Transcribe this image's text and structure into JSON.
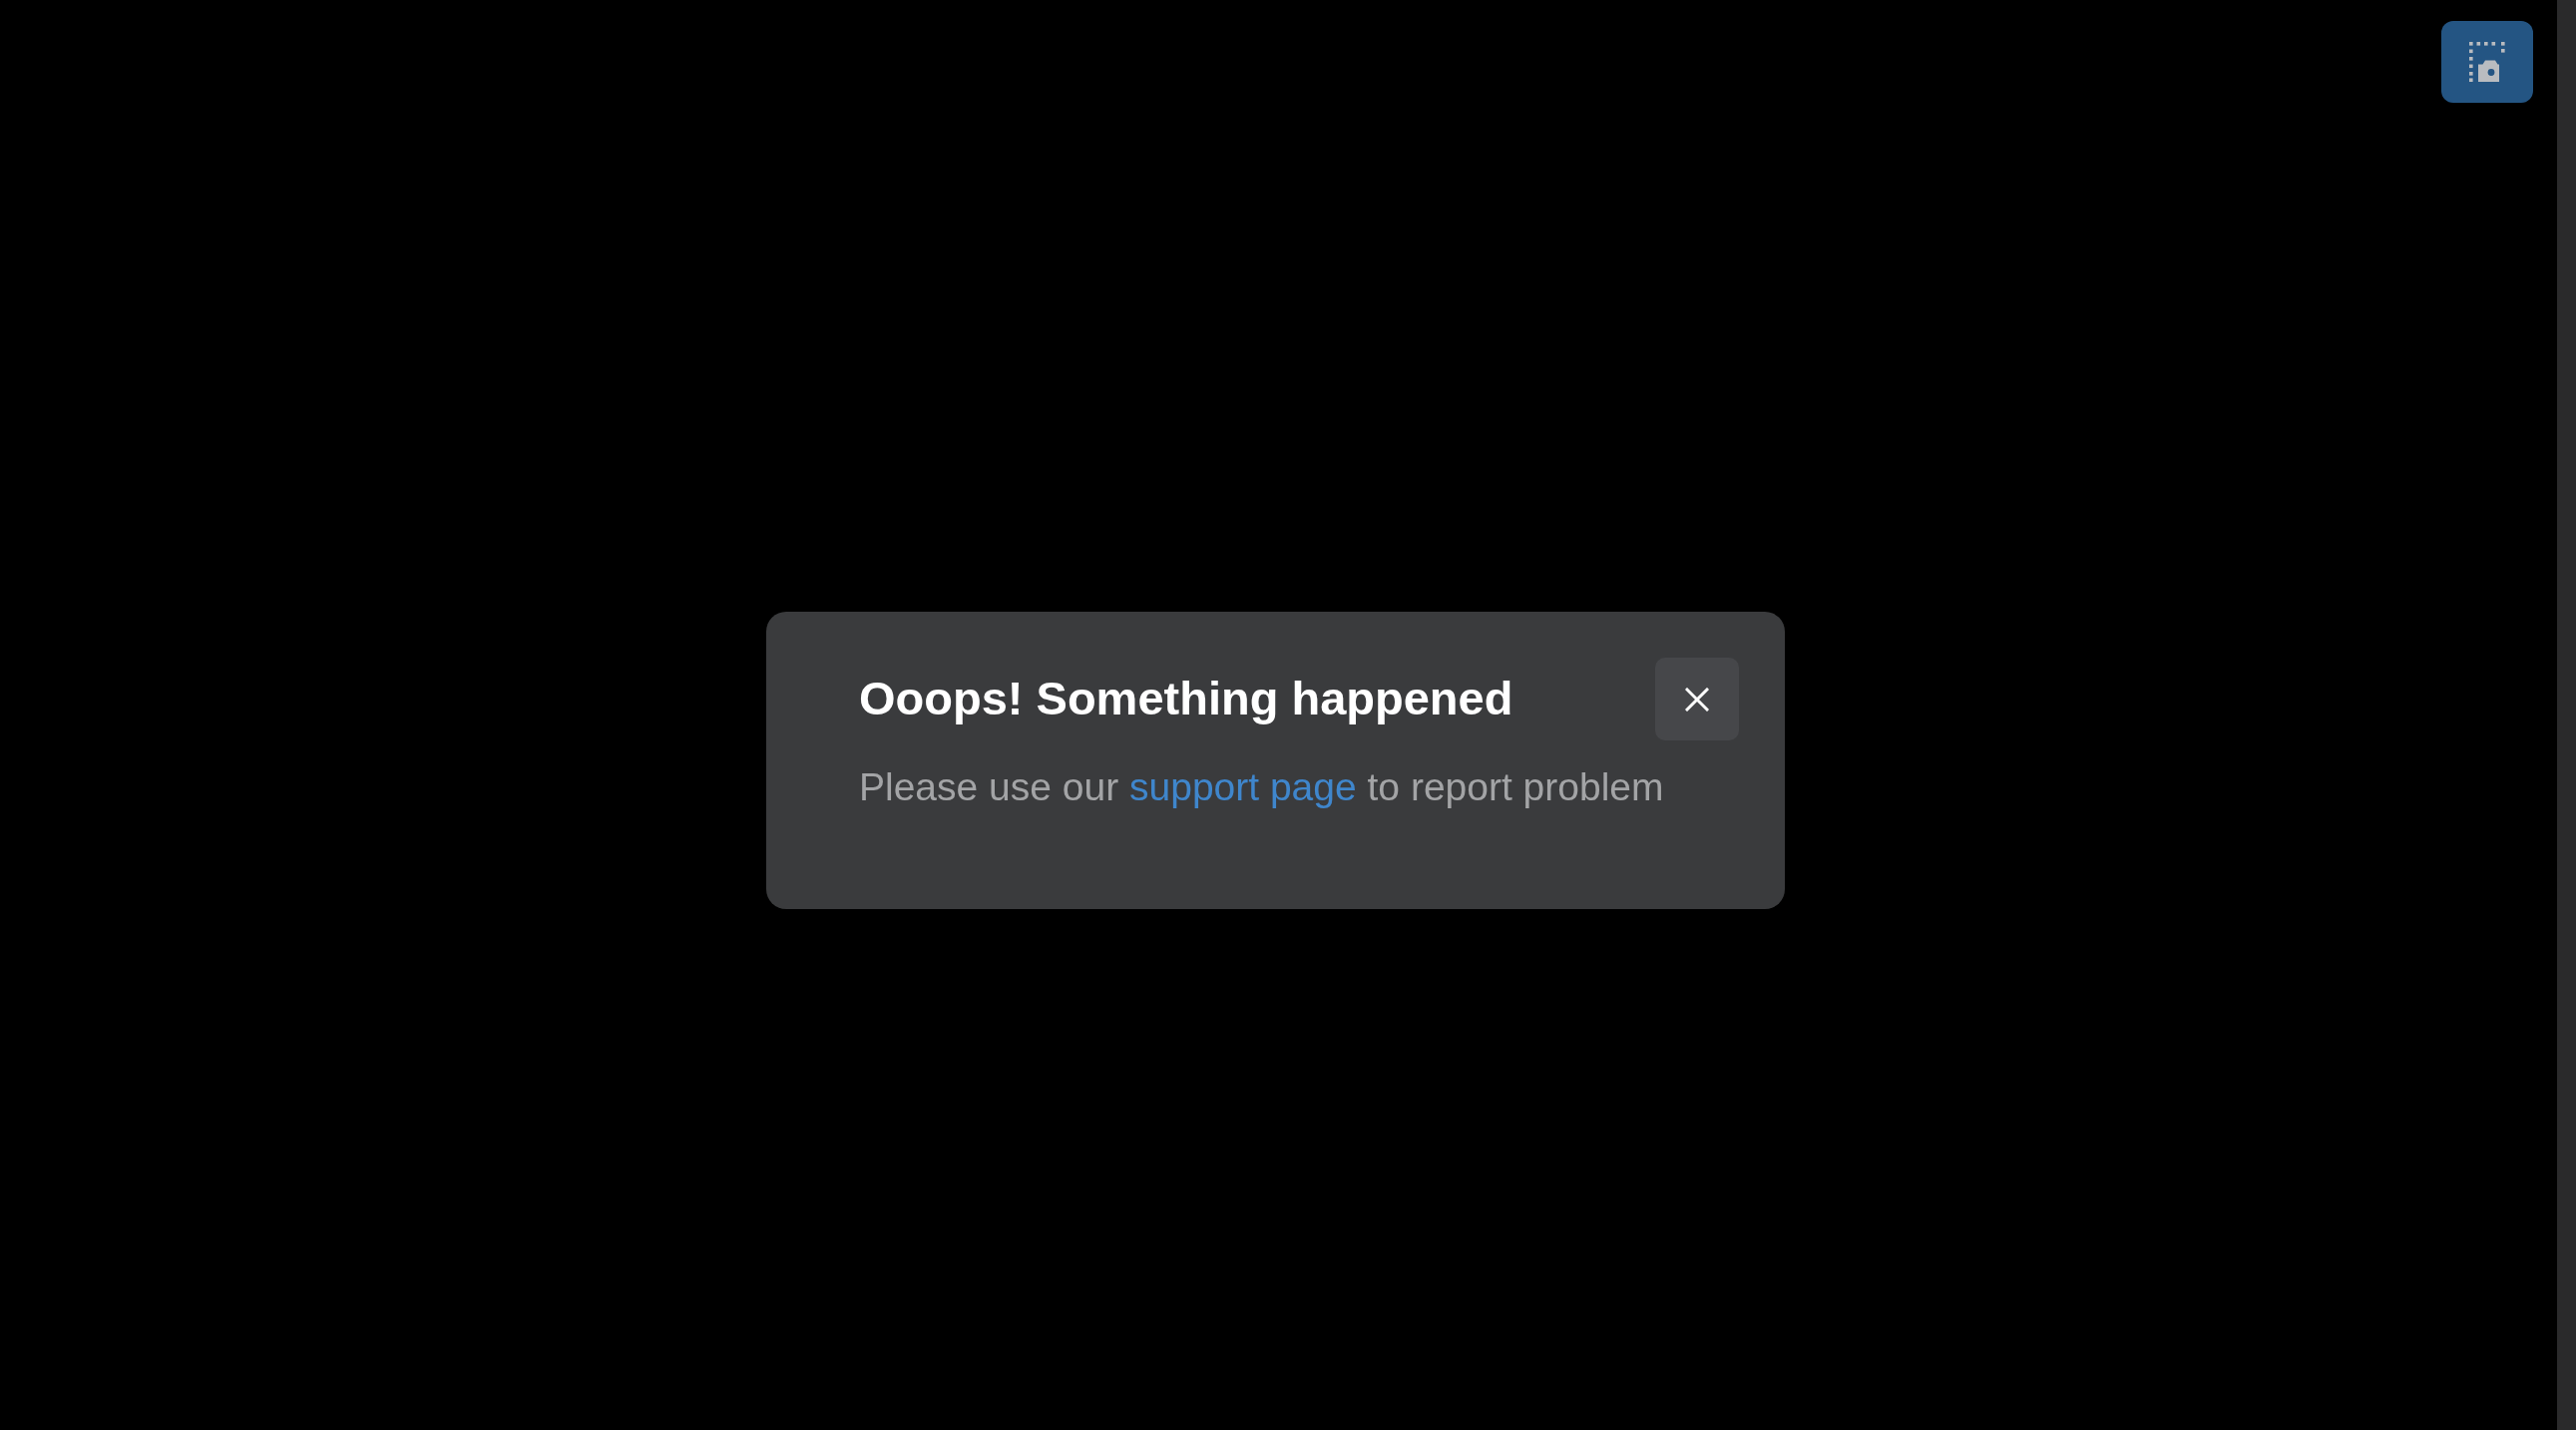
{
  "dialog": {
    "title": "Ooops! Something happened",
    "message": {
      "before": "Please use our ",
      "link": "support page",
      "after": " to report problem"
    }
  }
}
